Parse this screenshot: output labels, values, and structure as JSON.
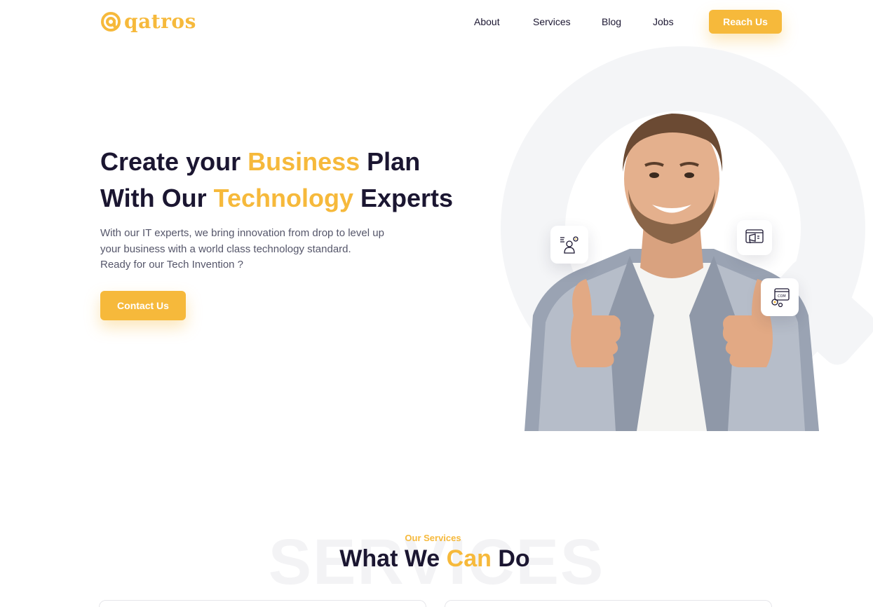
{
  "brand": {
    "name": "qatros",
    "color": "#f6b93b"
  },
  "nav": {
    "items": [
      {
        "label": "About"
      },
      {
        "label": "Services"
      },
      {
        "label": "Blog"
      },
      {
        "label": "Jobs"
      }
    ],
    "cta_label": "Reach Us"
  },
  "hero": {
    "title_line1": {
      "pre": "Create your ",
      "highlight": "Business",
      "post": " Plan"
    },
    "title_line2": {
      "pre": "With Our ",
      "highlight": "Technology",
      "post": " Experts"
    },
    "description": [
      "With our IT experts, we bring innovation from drop to level up",
      "your business with a world class technology standard.",
      "Ready for our Tech Invention ?"
    ],
    "cta_label": "Contact Us",
    "badges": [
      {
        "icon": "developer-gear-icon"
      },
      {
        "icon": "megaphone-icon"
      },
      {
        "icon": "com-settings-icon"
      }
    ]
  },
  "services": {
    "watermark": "SERVICES",
    "eyebrow": "Our Services",
    "title": {
      "pre": "What We ",
      "highlight": "Can",
      "post": " Do"
    }
  },
  "colors": {
    "accent": "#f6b93b",
    "text_dark": "#1b1631",
    "text_muted": "#55566a"
  }
}
